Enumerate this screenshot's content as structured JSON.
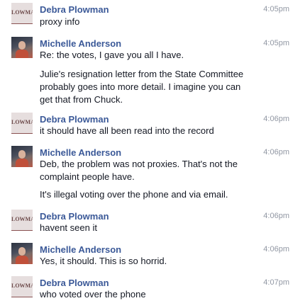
{
  "messages": [
    {
      "sender": "Debra Plowman",
      "avatar_text": "LOWMA",
      "time": "4:05pm",
      "lines": [
        "proxy info"
      ]
    },
    {
      "sender": "Michelle Anderson",
      "time": "4:05pm",
      "lines": [
        "Re: the votes, I gave you all I have.",
        "Julie's resignation letter from the State Committee",
        "probably goes into more detail. I imagine you can",
        "get that from Chuck."
      ]
    },
    {
      "sender": "Debra Plowman",
      "avatar_text": "LOWMA",
      "time": "4:06pm",
      "lines": [
        "it should have all been read into the record"
      ]
    },
    {
      "sender": "Michelle Anderson",
      "time": "4:06pm",
      "lines": [
        "Deb, the problem was not proxies. That's not the",
        "complaint people have.",
        "It's illegal voting over the phone and via email."
      ]
    },
    {
      "sender": "Debra Plowman",
      "avatar_text": "LOWMA",
      "time": "4:06pm",
      "lines": [
        "havent seen it"
      ]
    },
    {
      "sender": "Michelle Anderson",
      "time": "4:06pm",
      "lines": [
        "Yes, it should. This is so horrid."
      ]
    },
    {
      "sender": "Debra Plowman",
      "avatar_text": "LOWMA",
      "time": "4:07pm",
      "lines": [
        "who voted over the phone"
      ]
    }
  ]
}
